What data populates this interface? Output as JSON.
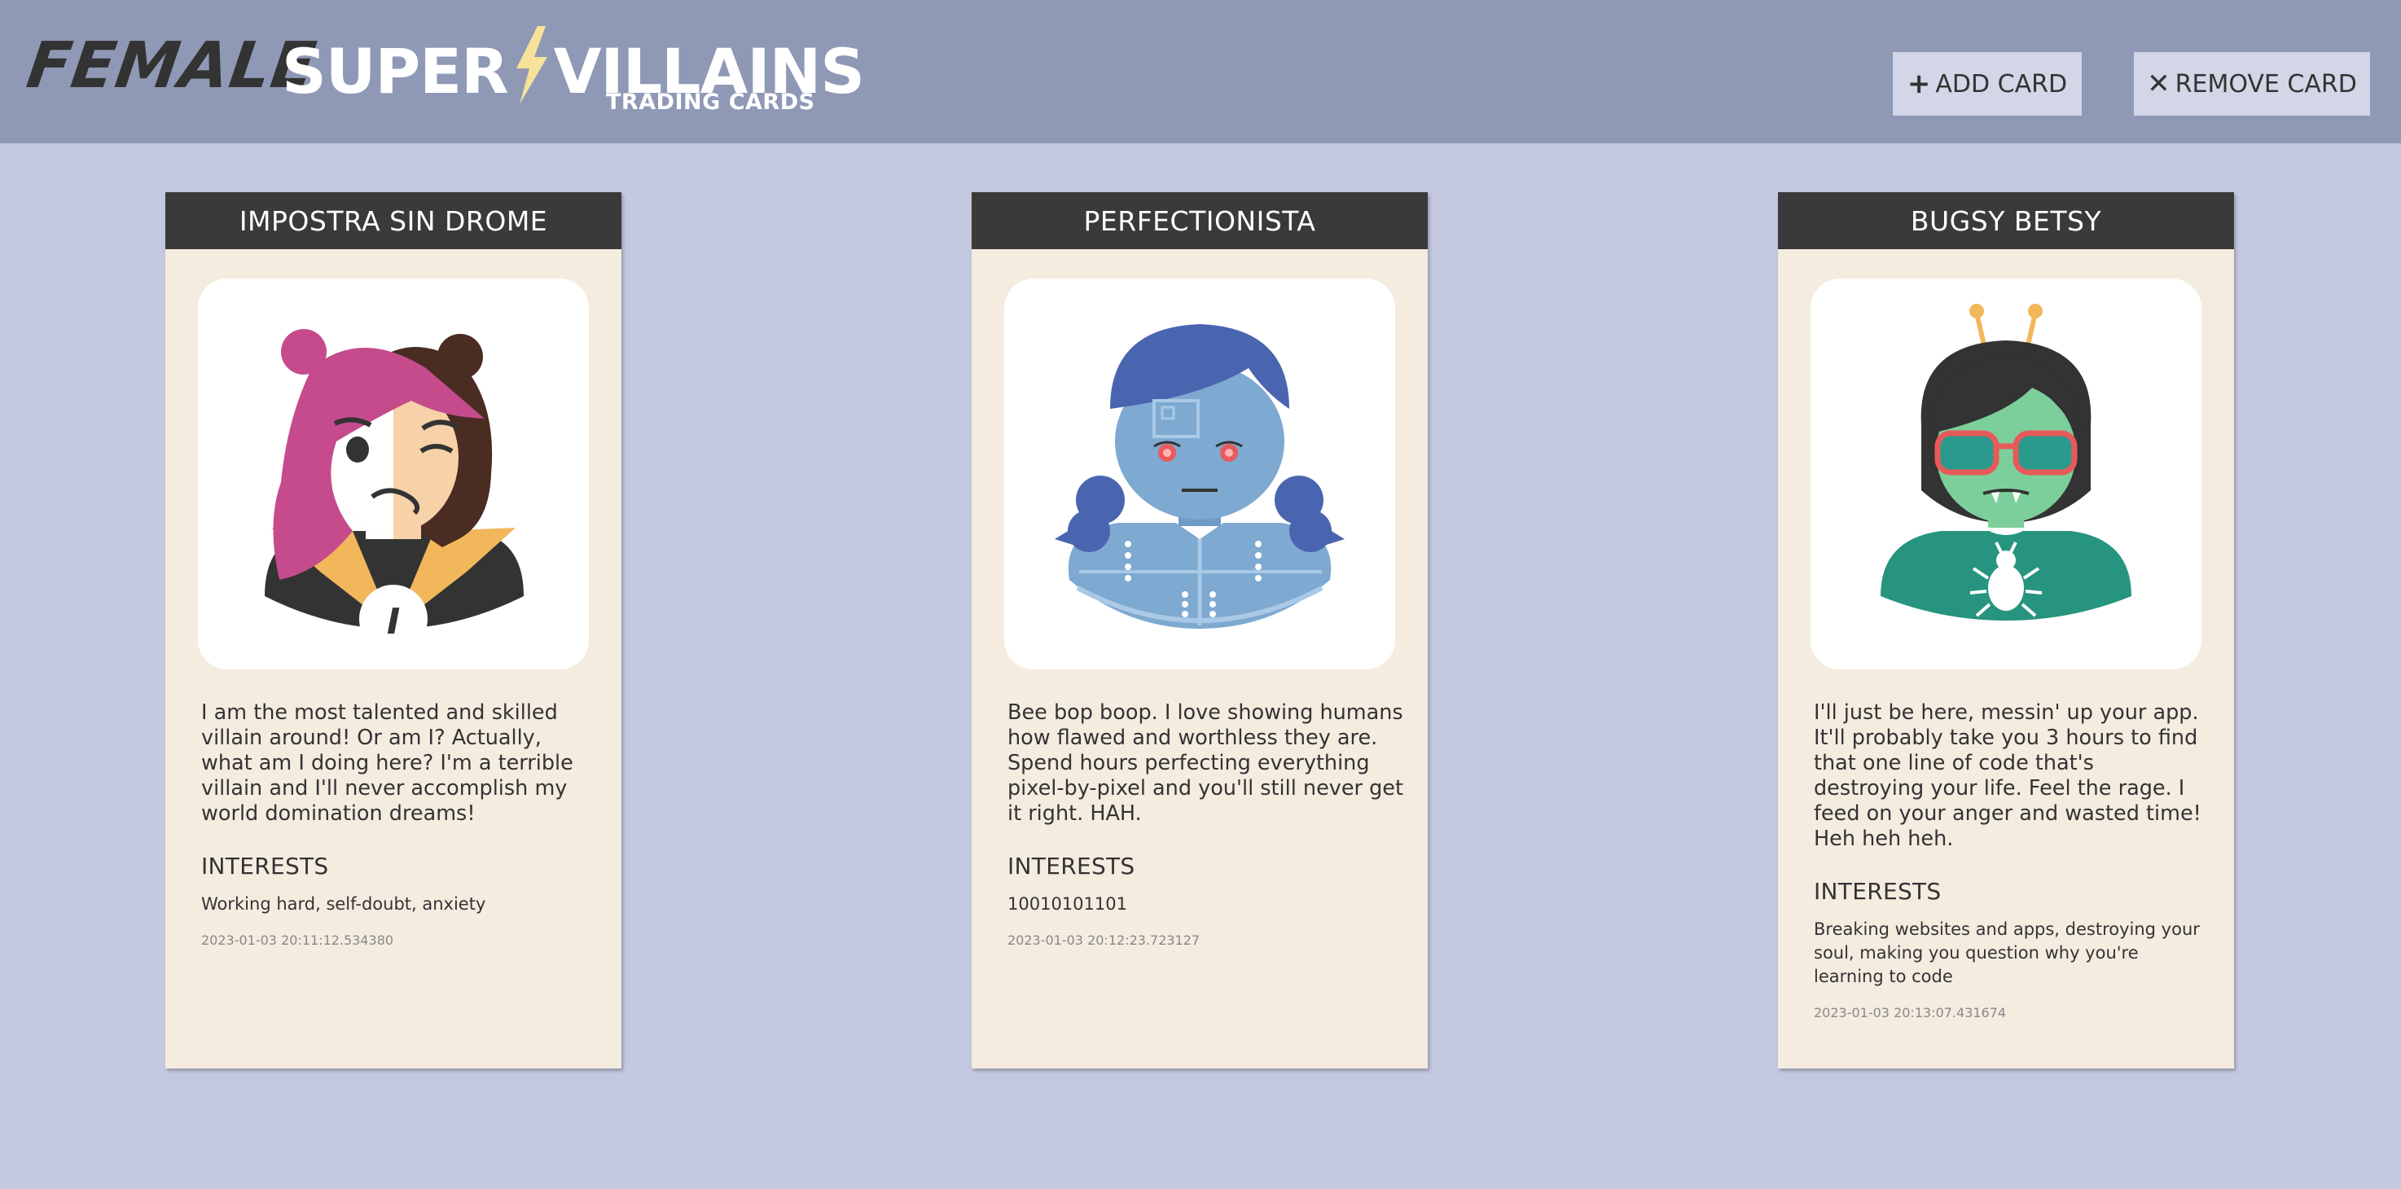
{
  "header": {
    "logo": {
      "word1": "FEMALE",
      "word2a": "SUPER",
      "word2b": "VILLAINS",
      "subtitle": "TRADING CARDS"
    },
    "add_button": {
      "icon": "plus-icon",
      "glyph": "+",
      "label": "ADD CARD"
    },
    "remove_button": {
      "icon": "x-icon",
      "glyph": "✕",
      "label": "REMOVE CARD"
    }
  },
  "colors": {
    "header_bg": "#8f99b6",
    "page_bg": "#c4c9df",
    "card_bg": "#f5ece0",
    "card_title_bg": "#3a3a3a",
    "bolt": "#f7e29a"
  },
  "cards": [
    {
      "name": "IMPOSTRA SIN DROME",
      "avatar": "two-faced-woman-avatar",
      "description": "I am the most talented and skilled villain around! Or am I? Actually, what am I doing here? I'm a terrible villain and I'll never accomplish my world domination dreams!",
      "interests_heading": "INTERESTS",
      "interests": "Working hard, self-doubt, anxiety",
      "timestamp": "2023-01-03 20:11:12.534380"
    },
    {
      "name": "PERFECTIONISTA",
      "avatar": "robot-girl-avatar",
      "description": "Bee bop boop. I love showing humans how flawed and worthless they are. Spend hours perfecting everything pixel-by-pixel and you'll still never get it right. HAH.",
      "interests_heading": "INTERESTS",
      "interests": "10010101101",
      "timestamp": "2023-01-03 20:12:23.723127"
    },
    {
      "name": "BUGSY BETSY",
      "avatar": "bug-girl-avatar",
      "description": "I'll just be here, messin' up your app. It'll probably take you 3 hours to find that one line of code that's destroying your life. Feel the rage. I feed on your anger and wasted time! Heh heh heh.",
      "interests_heading": "INTERESTS",
      "interests": "Breaking websites and apps, destroying your soul, making you question why you're learning to code",
      "timestamp": "2023-01-03 20:13:07.431674"
    }
  ]
}
